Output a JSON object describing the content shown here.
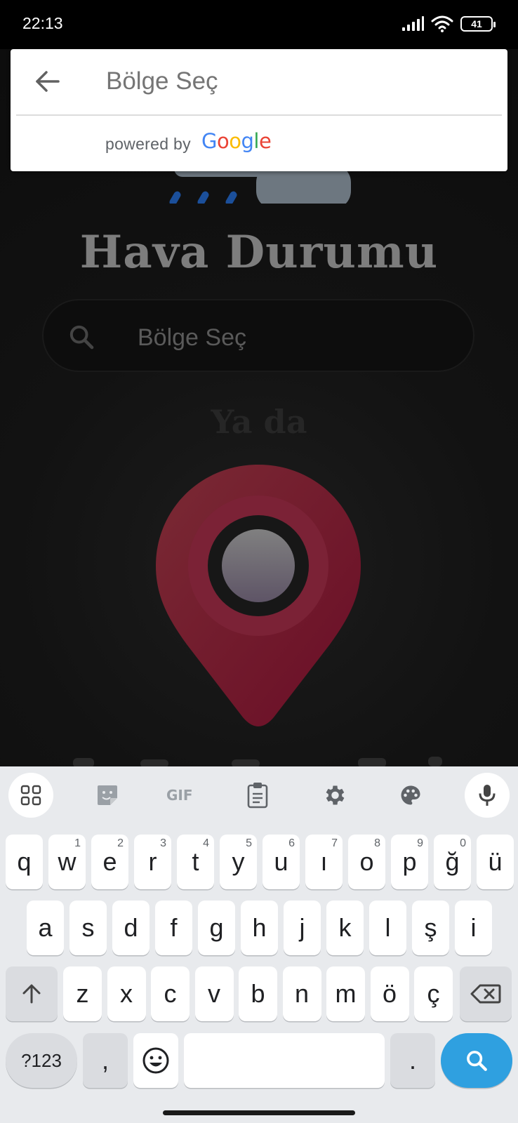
{
  "status_bar": {
    "time": "22:13",
    "battery": "41"
  },
  "autocomplete": {
    "placeholder": "Bölge Seç",
    "powered_by": "powered by",
    "google_letters": [
      "G",
      "o",
      "o",
      "g",
      "l",
      "e"
    ]
  },
  "app": {
    "title": "Hava Durumu",
    "search_placeholder": "Bölge Seç",
    "or_text": "Ya da"
  },
  "keyboard": {
    "row1": [
      {
        "k": "q",
        "h": ""
      },
      {
        "k": "w",
        "h": "1"
      },
      {
        "k": "e",
        "h": "2"
      },
      {
        "k": "r",
        "h": "3"
      },
      {
        "k": "t",
        "h": "4"
      },
      {
        "k": "y",
        "h": "5"
      },
      {
        "k": "u",
        "h": "6"
      },
      {
        "k": "ı",
        "h": "7"
      },
      {
        "k": "o",
        "h": "8"
      },
      {
        "k": "p",
        "h": "9"
      },
      {
        "k": "ğ",
        "h": "0"
      },
      {
        "k": "ü",
        "h": ""
      }
    ],
    "row2": [
      "a",
      "s",
      "d",
      "f",
      "g",
      "h",
      "j",
      "k",
      "l",
      "ş",
      "i"
    ],
    "row3": [
      "z",
      "x",
      "c",
      "v",
      "b",
      "n",
      "m",
      "ö",
      "ç"
    ],
    "symbols_label": "?123",
    "comma": ",",
    "period": "."
  },
  "icons": {
    "toolbar": [
      "apps-grid-icon",
      "sticker-icon",
      "gif-icon",
      "clipboard-icon",
      "settings-gear-icon",
      "palette-icon",
      "microphone-icon"
    ],
    "shift": "shift-arrow-icon",
    "backspace": "backspace-icon",
    "emoji": "emoji-icon",
    "enter": "search-icon"
  },
  "colors": {
    "accent_blue": "#2fa0e0",
    "pin_red": "#b0173a"
  }
}
